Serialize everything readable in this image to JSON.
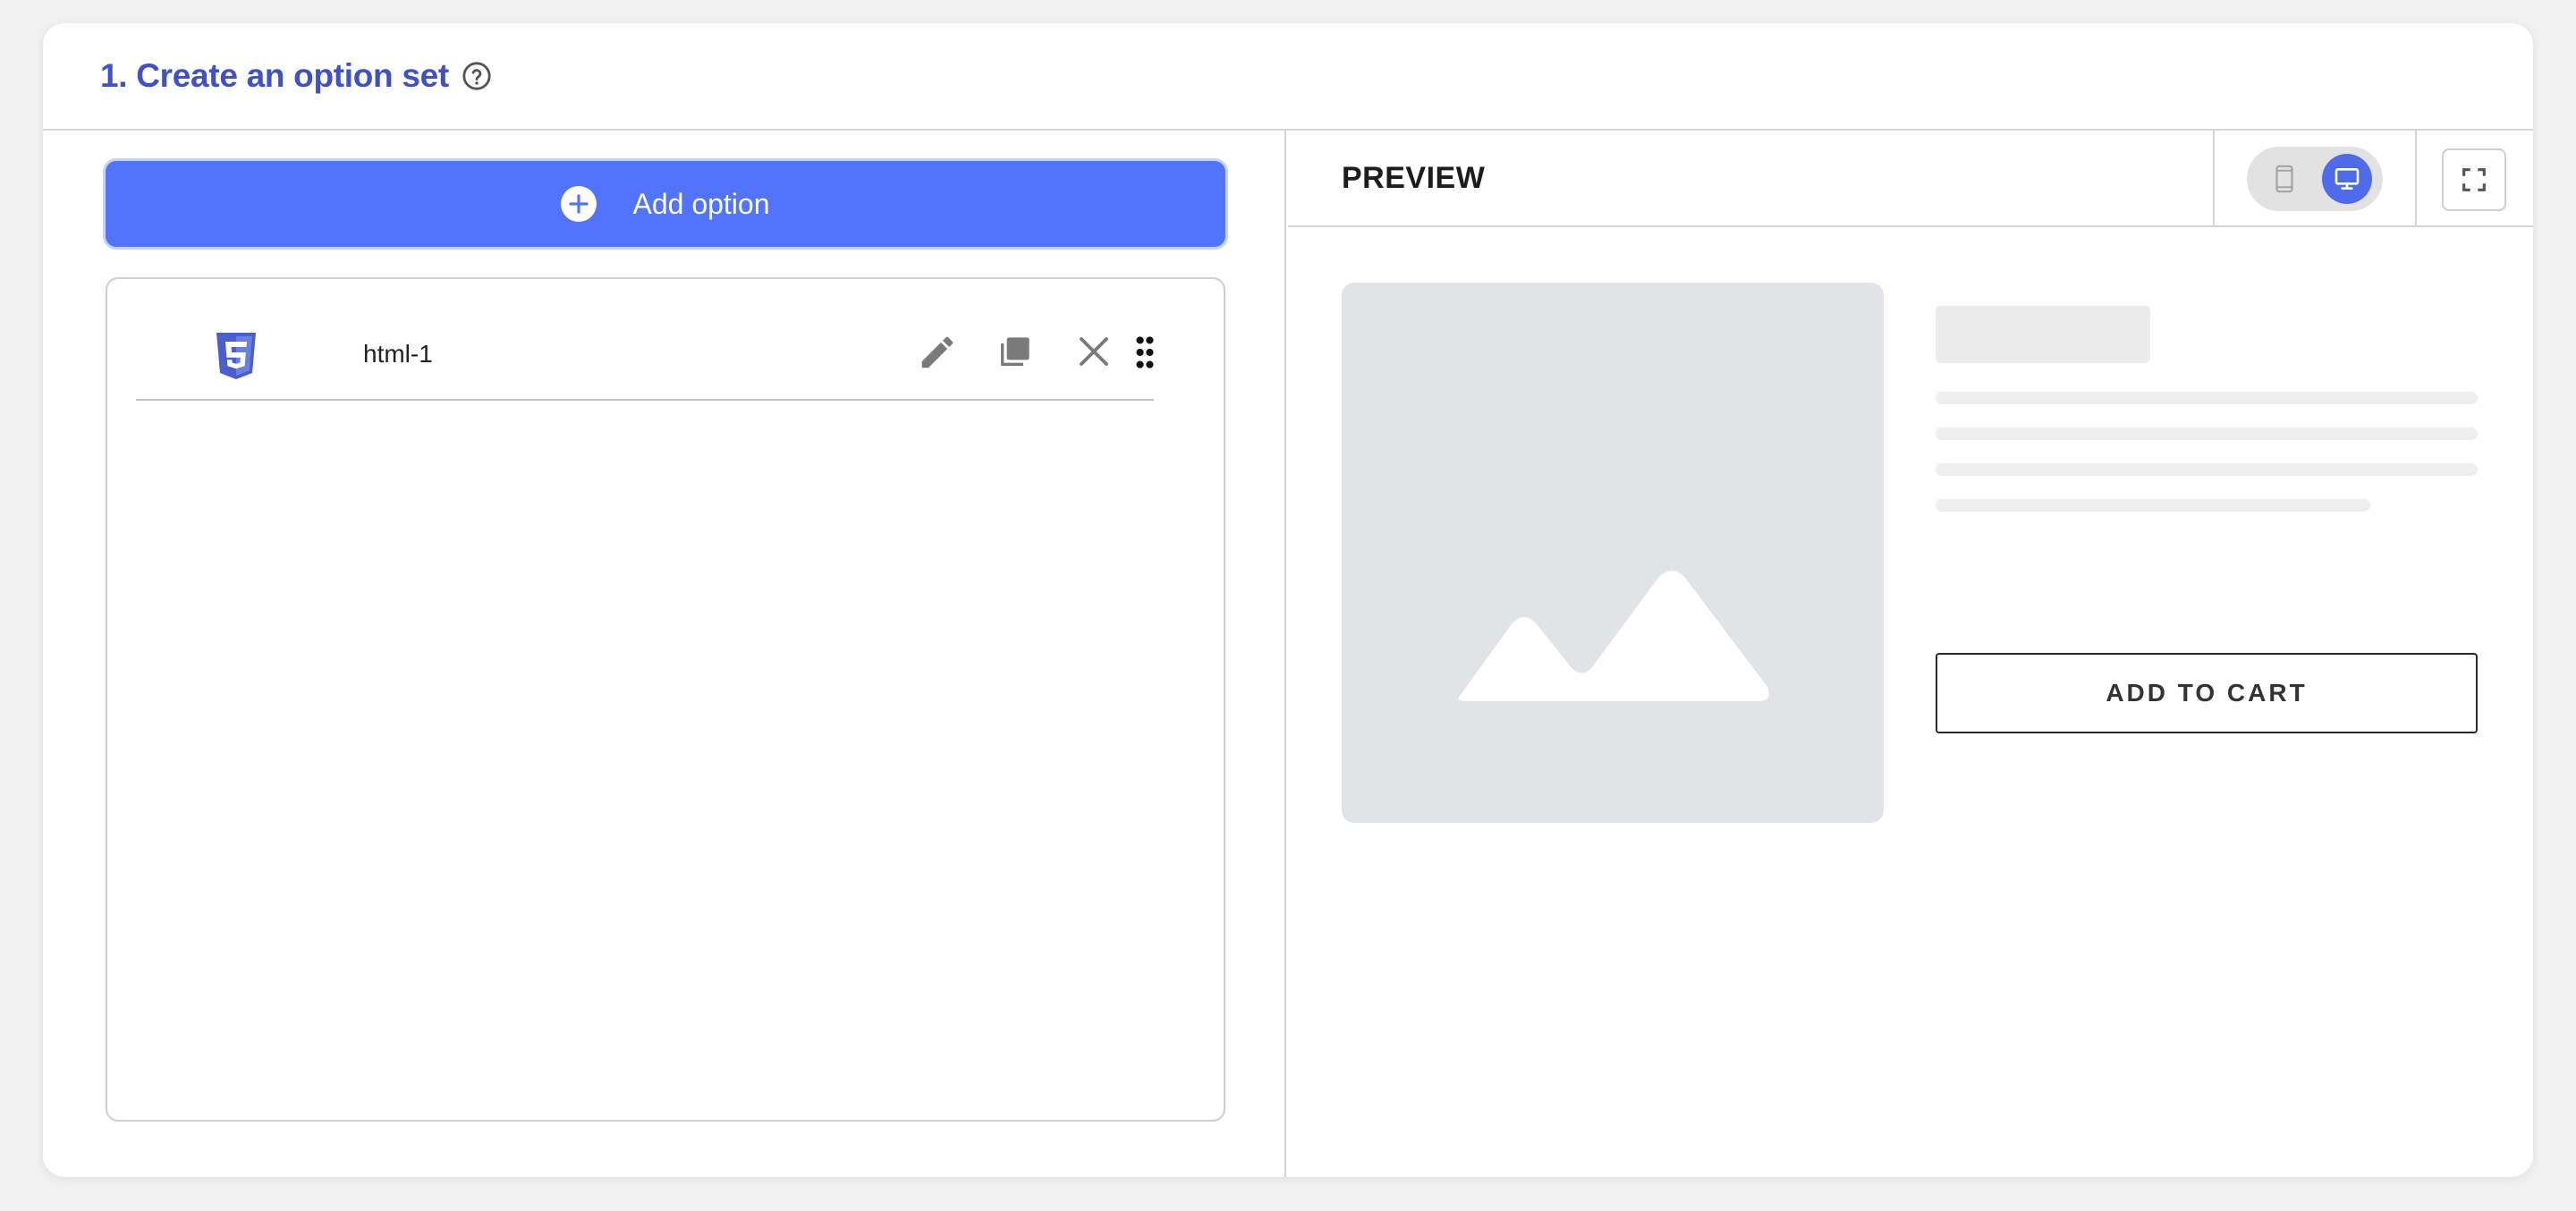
{
  "header": {
    "title": "1. Create an option set",
    "help_icon": "question-circle-icon"
  },
  "left": {
    "add_button_label": "Add option",
    "add_button_icon": "plus-circle-icon",
    "options": [
      {
        "name": "html-1",
        "type_icon": "html5-icon",
        "actions": [
          "edit-icon",
          "duplicate-icon",
          "close-icon",
          "drag-handle-icon"
        ]
      }
    ]
  },
  "preview": {
    "title": "PREVIEW",
    "device_modes": [
      "mobile-icon",
      "desktop-icon"
    ],
    "active_device": "desktop",
    "fullscreen_icon": "expand-icon",
    "image_placeholder_icon": "image-placeholder-icon",
    "add_to_cart_label": "ADD TO CART"
  },
  "colors": {
    "title_blue": "#3f51c4",
    "button_blue": "#5274fa",
    "toggle_active": "#4f6bea",
    "placeholder_bg": "#e2e3e7"
  }
}
